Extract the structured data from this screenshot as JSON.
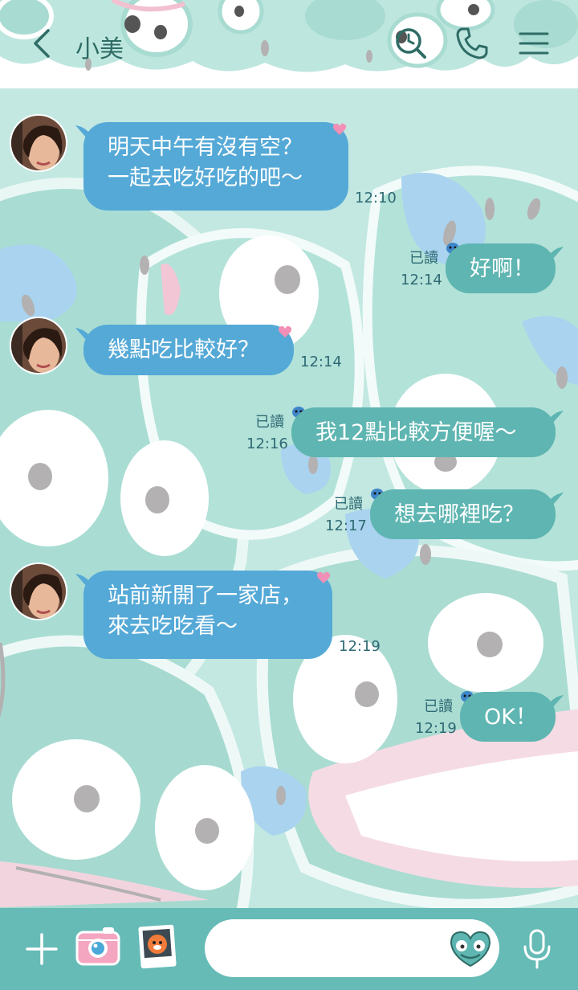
{
  "header": {
    "title": "小美"
  },
  "messages": [
    {
      "side": "in",
      "lines": [
        "明天中午有沒有空？",
        "一起去吃好吃的吧～"
      ],
      "time": "12:10"
    },
    {
      "side": "out",
      "text": "好啊！",
      "read": "已讀",
      "time": "12:14"
    },
    {
      "side": "in",
      "text": "幾點吃比較好？",
      "time": "12:14"
    },
    {
      "side": "out",
      "text": "我12點比較方便喔～",
      "read": "已讀",
      "time": "12:16"
    },
    {
      "side": "out",
      "text": "想去哪裡吃？",
      "read": "已讀",
      "time": "12:17"
    },
    {
      "side": "in",
      "lines": [
        "站前新開了一家店，",
        "來去吃吃看～"
      ],
      "time": "12:19"
    },
    {
      "side": "out",
      "text": "OK！",
      "read": "已讀",
      "time": "12:19"
    }
  ],
  "composer": {
    "placeholder": ""
  },
  "colors": {
    "incoming_bubble": "#55a9d7",
    "outgoing_bubble": "#5eb5b1",
    "bottom_bar": "#66bbb6",
    "background": "#bfe6df"
  },
  "icons": [
    "back-arrow-icon",
    "search-clock-icon",
    "phone-icon",
    "menu-icon",
    "plus-icon",
    "camera-icon",
    "photo-icon",
    "emoji-icon",
    "microphone-icon"
  ]
}
